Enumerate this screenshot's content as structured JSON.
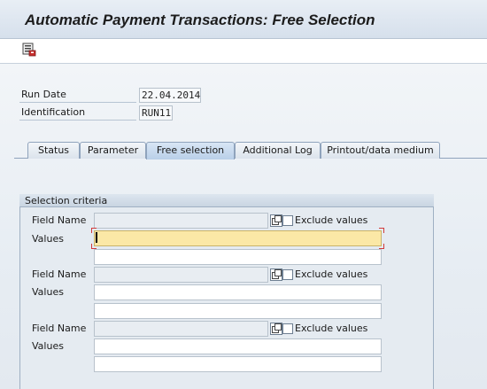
{
  "window": {
    "title": "Automatic Payment Transactions: Free Selection"
  },
  "toolbar": {
    "items": [
      {
        "icon": "save-variant-icon"
      }
    ]
  },
  "header": {
    "run_date_label": "Run Date",
    "run_date_value": "22.04.2014",
    "identification_label": "Identification",
    "identification_value": "RUN11"
  },
  "tabs": [
    {
      "label": "Status",
      "active": false
    },
    {
      "label": "Parameter",
      "active": false
    },
    {
      "label": "Free selection",
      "active": true
    },
    {
      "label": "Additional Log",
      "active": false
    },
    {
      "label": "Printout/data medium",
      "active": false
    }
  ],
  "selection": {
    "group_title": "Selection criteria",
    "field_name_label": "Field Name",
    "exclude_label": "Exclude values",
    "values_label": "Values",
    "rows": [
      {
        "field_name": "",
        "exclude": false,
        "values": [
          "",
          ""
        ]
      },
      {
        "field_name": "",
        "exclude": false,
        "values": [
          "",
          ""
        ]
      },
      {
        "field_name": "",
        "exclude": false,
        "values": [
          "",
          ""
        ]
      }
    ]
  },
  "colors": {
    "focus_field": "#fbe8a6",
    "title_bar": "#dbe4ee",
    "active_tab": "#c4d8ee"
  }
}
